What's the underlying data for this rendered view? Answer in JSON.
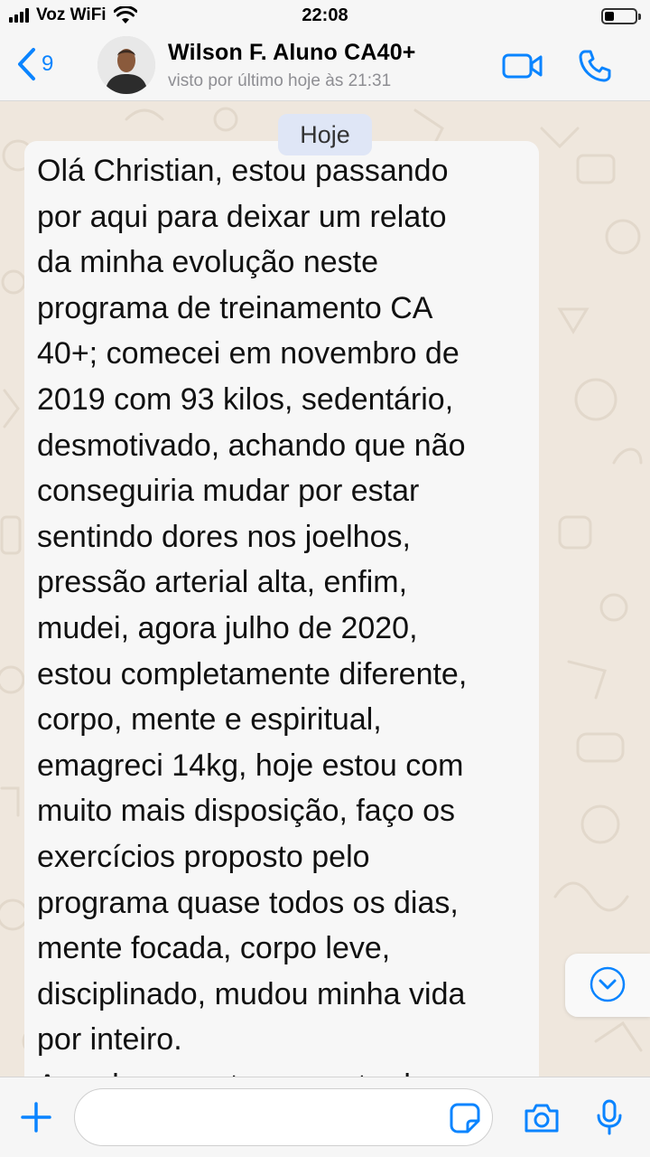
{
  "status_bar": {
    "carrier": "Voz WiFi",
    "time": "22:08"
  },
  "header": {
    "back_count": "9",
    "contact_name": "Wilson F. Aluno CA40+",
    "last_seen": "visto por último hoje às 21:31"
  },
  "chat": {
    "date_label": "Hoje",
    "message": "Olá Christian,  estou passando\npor aqui para deixar um relato\nda minha evolução neste\nprograma de treinamento CA\n40+; comecei em novembro de\n2019 com 93 kilos, sedentário,\ndesmotivado, achando que não\nconseguiria mudar por estar\nsentindo dores nos joelhos,\npressão arterial alta, enfim,\nmudei,  agora julho de 2020,\nestou completamente diferente,\ncorpo, mente e espiritual,\nemagreci 14kg,  hoje estou com\nmuito mais disposição, faço os\nexercícios proposto pelo\nprograma quase todos os dias,\nmente focada, corpo leve,\ndisciplinado, mudou minha vida\npor inteiro.\nAgradeço por ter encontrado"
  },
  "input": {
    "value": "",
    "placeholder": ""
  },
  "colors": {
    "accent": "#0a84ff",
    "chat_bg": "#efe7dd",
    "bubble": "#f7f7f7",
    "date_pill": "#dfe6f6"
  },
  "icons": [
    "signal-icon",
    "wifi-icon",
    "battery-icon",
    "back-chevron-icon",
    "video-call-icon",
    "phone-icon",
    "chevron-down-icon",
    "plus-icon",
    "sticker-icon",
    "camera-icon",
    "microphone-icon"
  ]
}
